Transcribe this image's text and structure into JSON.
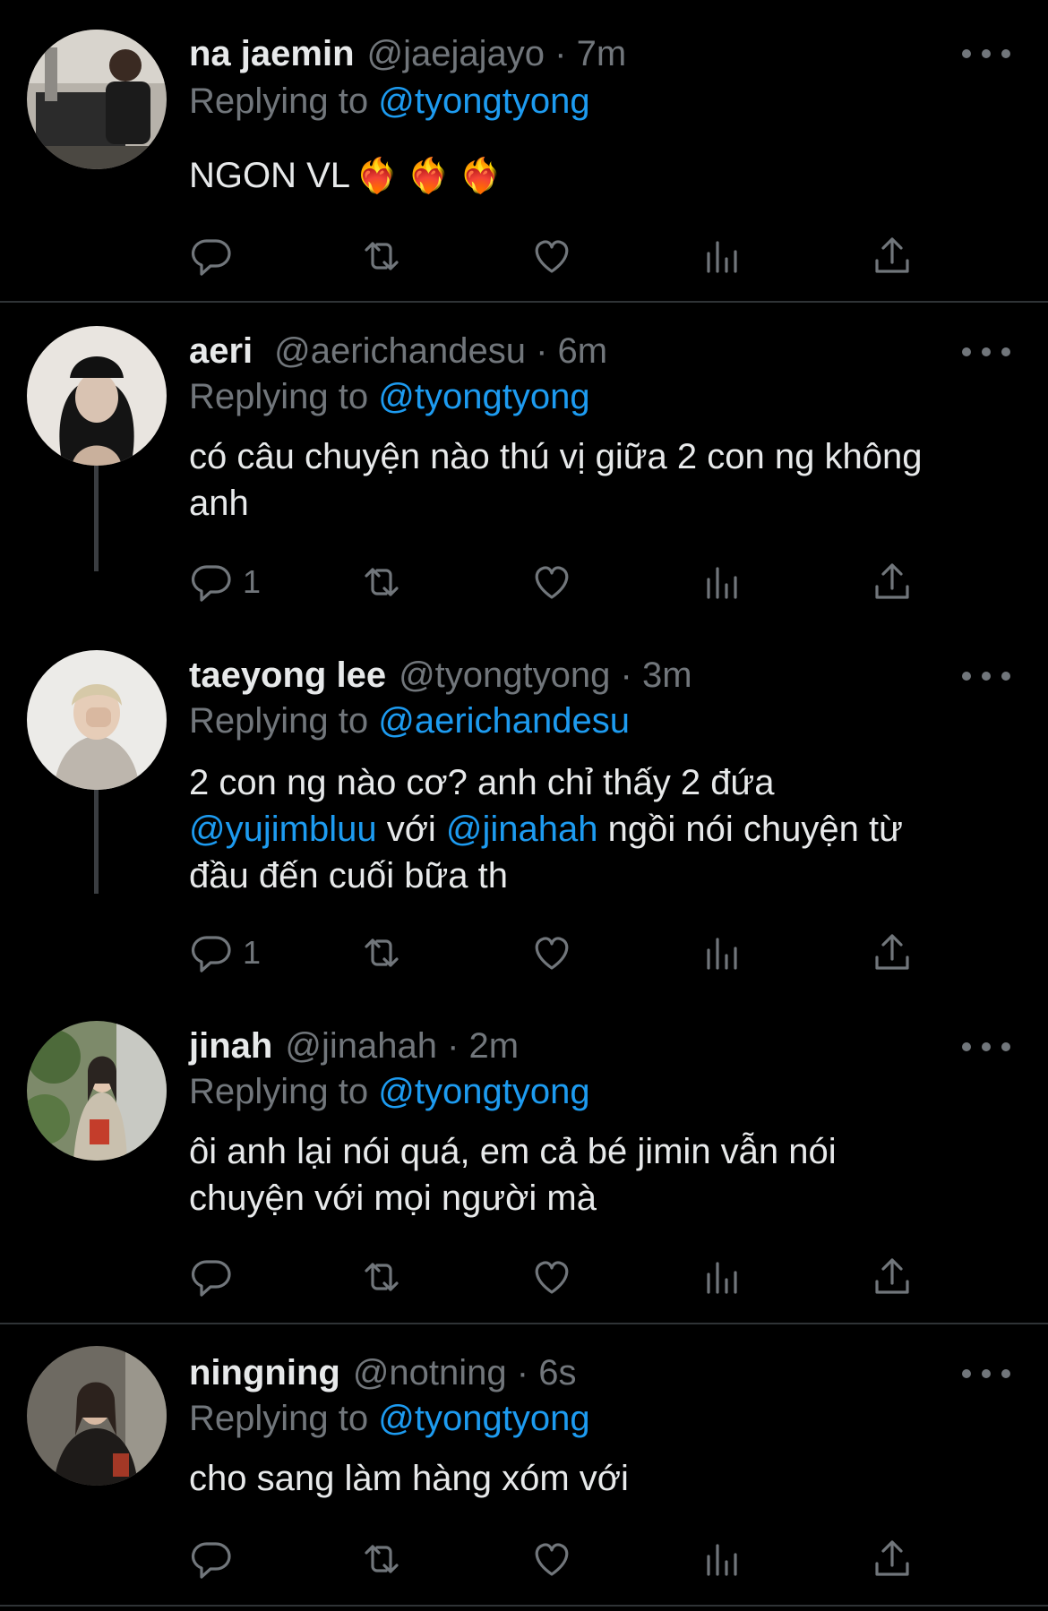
{
  "tweets": [
    {
      "name": "na jaemin",
      "handle": "@jaejajayo",
      "time": "7m",
      "replying_prefix": "Replying to",
      "replying_to": "@tyongtyong",
      "body_text": "NGON VL",
      "emojis": "❤️‍🔥 ❤️‍🔥 ❤️‍🔥",
      "reply_count": "",
      "avatar_icon": "avatar-photo"
    },
    {
      "name": "aeri",
      "handle": "@aerichandesu",
      "time": "6m",
      "replying_prefix": "Replying to",
      "replying_to": "@tyongtyong",
      "body_line1": "có câu chuyện nào thú vị giữa 2 con ng không",
      "body_line2": "anh",
      "reply_count": "1"
    },
    {
      "name": "taeyong lee",
      "handle": "@tyongtyong",
      "time": "3m",
      "replying_prefix": "Replying to",
      "replying_to": "@aerichandesu",
      "body_line1": "2 con ng nào cơ? anh chỉ thấy 2 đứa",
      "body_mention1": "@yujimbluu",
      "body_mid": " với ",
      "body_mention2": "@jinahah",
      "body_after": " ngồi nói chuyện từ",
      "body_line3": "đầu đến cuối bữa th",
      "reply_count": "1"
    },
    {
      "name": "jinah",
      "handle": "@jinahah",
      "time": "2m",
      "replying_prefix": "Replying to",
      "replying_to": "@tyongtyong",
      "body_line1": "ôi anh lại nói quá, em cả bé jimin vẫn nói",
      "body_line2": "chuyện với mọi người mà",
      "reply_count": ""
    },
    {
      "name": "ningning",
      "handle": "@notning",
      "time": "6s",
      "replying_prefix": "Replying to",
      "replying_to": "@tyongtyong",
      "body_line1": "cho sang làm hàng xóm với",
      "reply_count": ""
    }
  ],
  "dot_separator": "·",
  "colors": {
    "background": "#000000",
    "text": "#e7e9ea",
    "muted": "#71767b",
    "link": "#1d9bf0"
  }
}
